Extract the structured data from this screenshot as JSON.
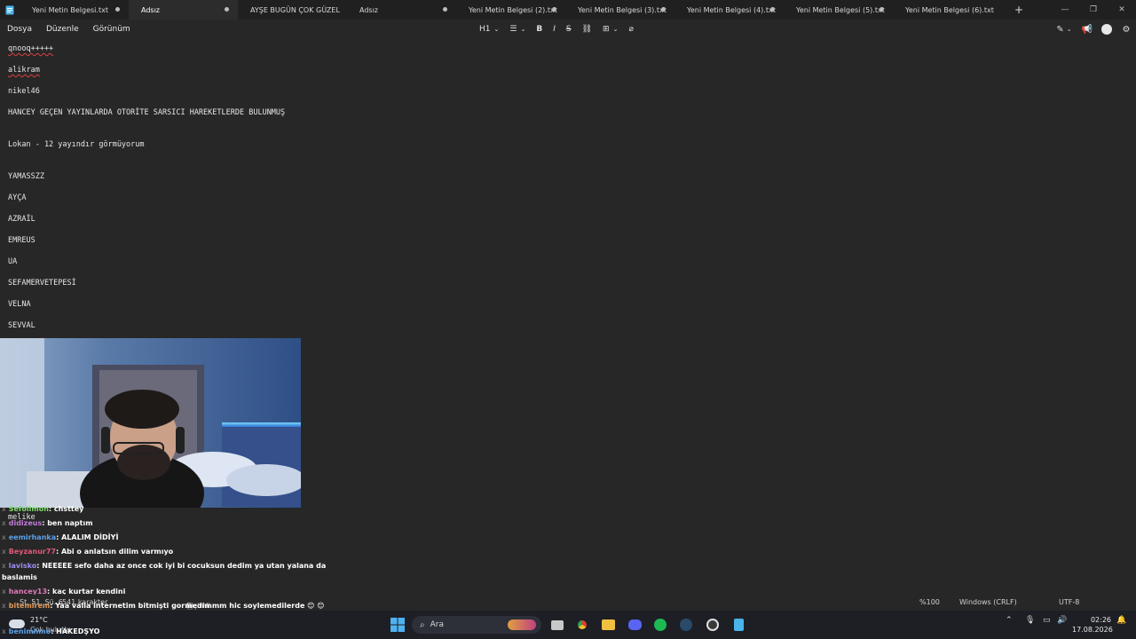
{
  "tabs": [
    {
      "label": "Yeni Metin Belgesi.txt"
    },
    {
      "label": "Adsız"
    },
    {
      "label": "AYŞE BUGÜN ÇOK GÜZEL"
    },
    {
      "label": "Adsız"
    },
    {
      "label": "Yeni Metin Belgesi (2).txt"
    },
    {
      "label": "Yeni Metin Belgesi (3).txt"
    },
    {
      "label": "Yeni Metin Belgesi (4).txt"
    },
    {
      "label": "Yeni Metin Belgesi (5).txt"
    },
    {
      "label": "Yeni Metin Belgesi (6).txt"
    }
  ],
  "new_tab_icon": "+",
  "menu": {
    "file": "Dosya",
    "edit": "Düzenle",
    "view": "Görünüm"
  },
  "format_toolbar": {
    "heading": "H1",
    "bold": "B",
    "italic": "I",
    "strike": "S"
  },
  "editor_lines": [
    "qnooq+++++",
    "alikram",
    "nikel46",
    "HANCEY GEÇEN YAYINLARDA OTORİTE SARSICI HAREKETLERDE BULUNMUŞ",
    "Lokan - 12 yayındır görmüyorum",
    "YAMASSZZ",
    "AYÇA",
    "AZRAİL",
    "EMREUS",
    "UA",
    "SEFAMERVETEPESİ",
    "VELNA",
    "SEVVAL",
    "melike"
  ],
  "chat": [
    {
      "user": "Sefolimon",
      "text": ": chsttey",
      "color": "#7ee06a"
    },
    {
      "user": "didizeus",
      "text": ": ben naptım",
      "color": "#c07bd8"
    },
    {
      "user": "eemirhanka",
      "text": ": ALALIM DİDİYİ",
      "color": "#5aa0e8"
    },
    {
      "user": "Beyzanur77",
      "text": ": Abi o anlatsın dilim varmıyo",
      "color": "#e05a7a"
    },
    {
      "user": "lavisko",
      "text": ": NEEEEE sefo daha az once cok iyi bi cocuksun dedim ya utan yalana da",
      "color": "#9a8ef0",
      "wrap": "baslamis"
    },
    {
      "user": "hancey13",
      "text": ": kaç kurtar kendini",
      "color": "#e07ab8"
    },
    {
      "user": "bitemirem",
      "text": ": Yaa valla internetim bitmişti gormedimmm hic soylemedilerde 😊 😊",
      "color": "#e09a5a"
    },
    {
      "user": "benimhmo",
      "text": ": HAKEDŞYO",
      "color": "#5aa0e8"
    }
  ],
  "statusbar": {
    "position": "St. 51, Sü. 6",
    "chars": "541 karakter",
    "format": "Biçimli",
    "zoom": "%100",
    "line_ending": "Windows (CRLF)",
    "encoding": "UTF-8"
  },
  "taskbar": {
    "weather_temp": "21°C",
    "weather_desc": "Çok bulutlu",
    "search_placeholder": "Ara",
    "time": "02:26",
    "date": "17.08.2026"
  }
}
